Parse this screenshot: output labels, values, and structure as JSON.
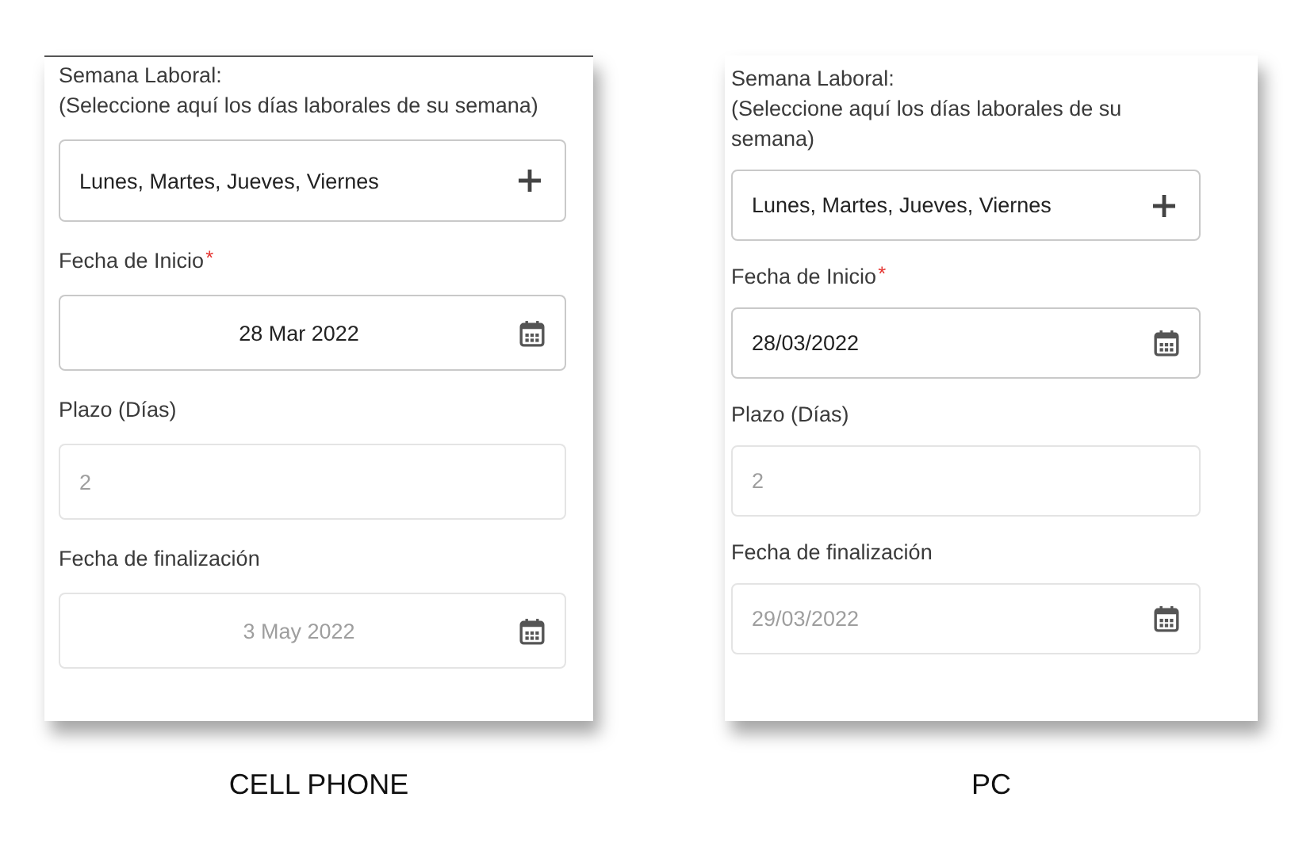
{
  "panels": [
    {
      "kind": "mobile",
      "caption": "CELL PHONE",
      "fields": [
        {
          "label": "Semana Laboral:\n(Seleccione aquí los días laborales de su semana)",
          "kind": "select",
          "value": "Lunes, Martes, Jueves, Viernes",
          "disabled": false
        },
        {
          "label": "Fecha de Inicio",
          "required_mark": "*",
          "kind": "date",
          "value": "28 Mar 2022",
          "disabled": false
        },
        {
          "label": "Plazo (Días)",
          "kind": "number",
          "value": "2",
          "disabled": true
        },
        {
          "label": "Fecha de finalización",
          "kind": "date",
          "value": "3 May 2022",
          "disabled": true
        }
      ]
    },
    {
      "kind": "desktop",
      "caption": "PC",
      "fields": [
        {
          "label": "Semana Laboral:\n(Seleccione aquí los días laborales de su semana)",
          "kind": "select",
          "value": "Lunes, Martes, Jueves, Viernes",
          "disabled": false
        },
        {
          "label": "Fecha de Inicio",
          "required_mark": "*",
          "kind": "date",
          "value": "28/03/2022",
          "disabled": false
        },
        {
          "label": "Plazo (Días)",
          "kind": "number",
          "value": "2",
          "disabled": true
        },
        {
          "label": "Fecha de finalización",
          "kind": "date",
          "value": "29/03/2022",
          "disabled": true
        }
      ]
    }
  ]
}
